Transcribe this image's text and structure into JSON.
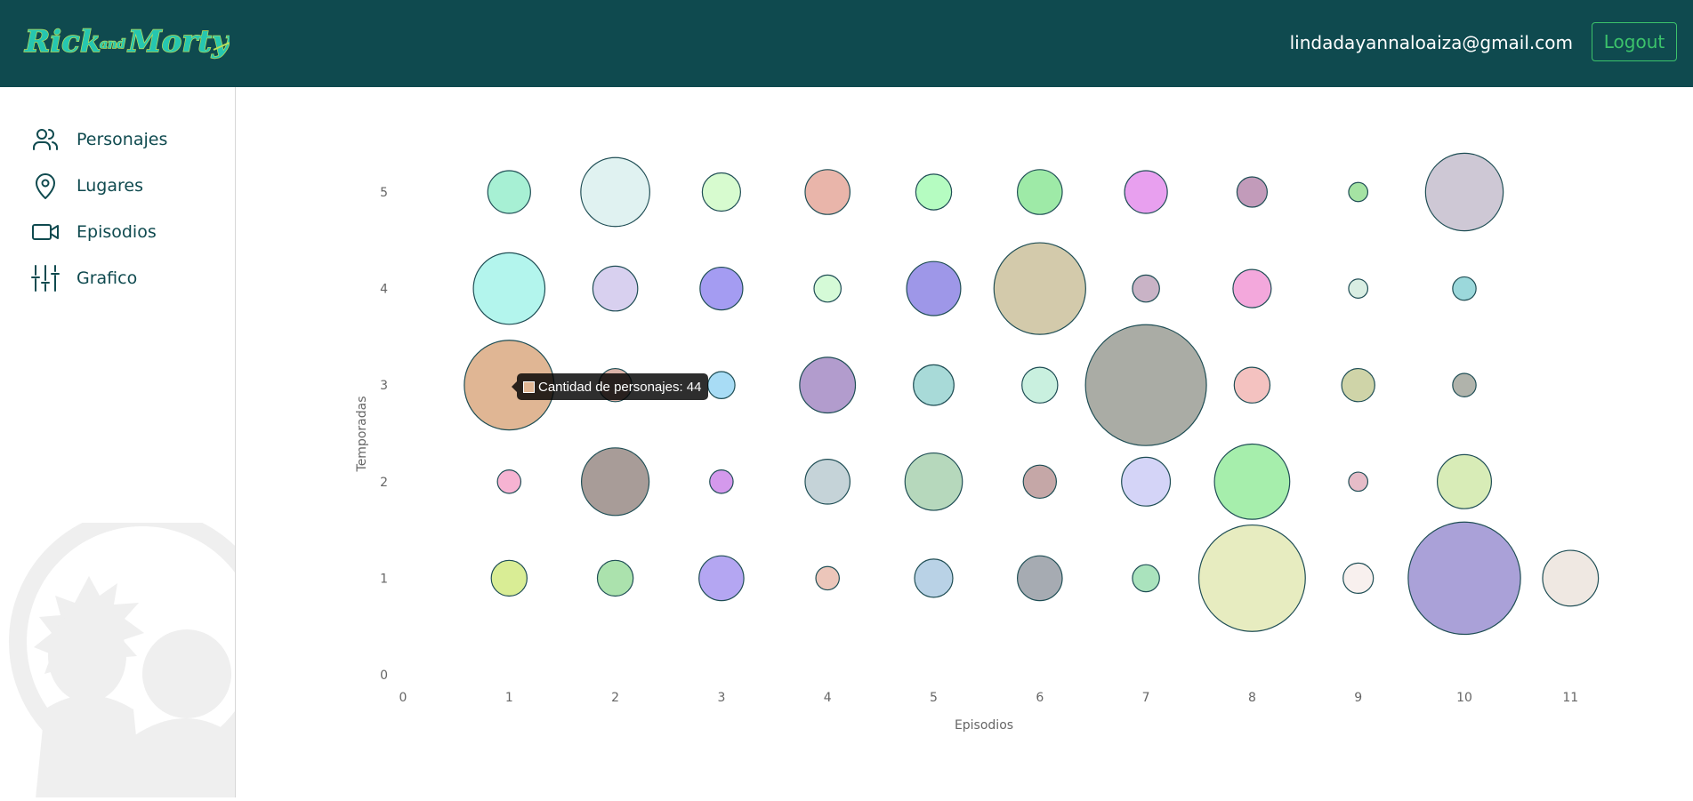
{
  "header": {
    "logo_text": "Rick and Morty",
    "user_email": "lindadayannaloaiza@gmail.com",
    "logout_label": "Logout",
    "colors": {
      "background": "#0f4a4f",
      "logout": "#3cc36b"
    }
  },
  "sidebar": {
    "items": [
      {
        "label": "Personajes",
        "icon": "users-icon"
      },
      {
        "label": "Lugares",
        "icon": "map-pin-icon"
      },
      {
        "label": "Episodios",
        "icon": "video-camera-icon"
      },
      {
        "label": "Grafico",
        "icon": "sliders-icon"
      }
    ],
    "watermark_icon": "rick-and-morty-silhouette-icon"
  },
  "tooltip": {
    "text": "Cantidad de personajes: 44",
    "swatch_color": "#e0b694"
  },
  "chart_data": {
    "type": "bubble",
    "xlabel": "Episodios",
    "ylabel": "Temporadas",
    "xlim": [
      0,
      11
    ],
    "ylim": [
      0,
      5
    ],
    "xticks": [
      "0",
      "1",
      "2",
      "3",
      "4",
      "5",
      "6",
      "7",
      "8",
      "9",
      "10",
      "11"
    ],
    "yticks": [
      "0",
      "1",
      "2",
      "3",
      "4",
      "5"
    ],
    "grid": false,
    "size_label": "Cantidad de personajes",
    "points": [
      {
        "x": 1,
        "y": 5,
        "size": 10,
        "color": "#a7f0d4"
      },
      {
        "x": 2,
        "y": 5,
        "size": 26,
        "color": "#e0f2f1"
      },
      {
        "x": 3,
        "y": 5,
        "size": 8,
        "color": "#d7fbcf"
      },
      {
        "x": 4,
        "y": 5,
        "size": 11,
        "color": "#e9b5aa"
      },
      {
        "x": 5,
        "y": 5,
        "size": 7,
        "color": "#b5fcc1"
      },
      {
        "x": 6,
        "y": 5,
        "size": 11,
        "color": "#9eeaa7"
      },
      {
        "x": 7,
        "y": 5,
        "size": 10,
        "color": "#e8a0ef"
      },
      {
        "x": 8,
        "y": 5,
        "size": 5,
        "color": "#c29bba"
      },
      {
        "x": 9,
        "y": 5,
        "size": 2,
        "color": "#a5e3a3"
      },
      {
        "x": 10,
        "y": 5,
        "size": 33,
        "color": "#cec8d5"
      },
      {
        "x": 1,
        "y": 4,
        "size": 28,
        "color": "#b3f5ed"
      },
      {
        "x": 2,
        "y": 4,
        "size": 11,
        "color": "#d8d0ef"
      },
      {
        "x": 3,
        "y": 4,
        "size": 10,
        "color": "#a49cf2"
      },
      {
        "x": 4,
        "y": 4,
        "size": 4,
        "color": "#d5fad7"
      },
      {
        "x": 5,
        "y": 4,
        "size": 16,
        "color": "#9e97e8"
      },
      {
        "x": 6,
        "y": 4,
        "size": 46,
        "color": "#d3caab"
      },
      {
        "x": 7,
        "y": 4,
        "size": 4,
        "color": "#c9b3c6"
      },
      {
        "x": 8,
        "y": 4,
        "size": 8,
        "color": "#f3a8dc"
      },
      {
        "x": 9,
        "y": 4,
        "size": 2,
        "color": "#d9eee3"
      },
      {
        "x": 10,
        "y": 4,
        "size": 3,
        "color": "#9bd8db"
      },
      {
        "x": 1,
        "y": 3,
        "size": 44,
        "color": "#e0b694"
      },
      {
        "x": 2,
        "y": 3,
        "size": 6,
        "color": "#dcb3a8"
      },
      {
        "x": 3,
        "y": 3,
        "size": 4,
        "color": "#a8dcf5"
      },
      {
        "x": 4,
        "y": 3,
        "size": 17,
        "color": "#b29ccd"
      },
      {
        "x": 5,
        "y": 3,
        "size": 9,
        "color": "#a8dad8"
      },
      {
        "x": 6,
        "y": 3,
        "size": 7,
        "color": "#c9f0df"
      },
      {
        "x": 7,
        "y": 3,
        "size": 80,
        "color": "#aaaca5"
      },
      {
        "x": 8,
        "y": 3,
        "size": 7,
        "color": "#f4c2c0"
      },
      {
        "x": 9,
        "y": 3,
        "size": 6,
        "color": "#cfd4a8"
      },
      {
        "x": 10,
        "y": 3,
        "size": 3,
        "color": "#b0b3ab"
      },
      {
        "x": 1,
        "y": 2,
        "size": 3,
        "color": "#f6b3d2"
      },
      {
        "x": 2,
        "y": 2,
        "size": 25,
        "color": "#a89c98"
      },
      {
        "x": 3,
        "y": 2,
        "size": 3,
        "color": "#d499ec"
      },
      {
        "x": 4,
        "y": 2,
        "size": 11,
        "color": "#c5d3d8"
      },
      {
        "x": 5,
        "y": 2,
        "size": 18,
        "color": "#b6d8bc"
      },
      {
        "x": 6,
        "y": 2,
        "size": 6,
        "color": "#c5a7a7"
      },
      {
        "x": 7,
        "y": 2,
        "size": 13,
        "color": "#d4d4f7"
      },
      {
        "x": 8,
        "y": 2,
        "size": 31,
        "color": "#a6eeac"
      },
      {
        "x": 9,
        "y": 2,
        "size": 2,
        "color": "#e6bcc8"
      },
      {
        "x": 10,
        "y": 2,
        "size": 16,
        "color": "#d8ecb7"
      },
      {
        "x": 1,
        "y": 1,
        "size": 7,
        "color": "#d9ed95"
      },
      {
        "x": 2,
        "y": 1,
        "size": 7,
        "color": "#abe2ad"
      },
      {
        "x": 3,
        "y": 1,
        "size": 11,
        "color": "#b4a6f2"
      },
      {
        "x": 4,
        "y": 1,
        "size": 3,
        "color": "#ecc6ba"
      },
      {
        "x": 5,
        "y": 1,
        "size": 8,
        "color": "#b9d2e6"
      },
      {
        "x": 6,
        "y": 1,
        "size": 11,
        "color": "#a6abb2"
      },
      {
        "x": 7,
        "y": 1,
        "size": 4,
        "color": "#aae3bd"
      },
      {
        "x": 8,
        "y": 1,
        "size": 62,
        "color": "#e7ecc0"
      },
      {
        "x": 9,
        "y": 1,
        "size": 5,
        "color": "#f8f0ee"
      },
      {
        "x": 10,
        "y": 1,
        "size": 69,
        "color": "#aaa1d8"
      },
      {
        "x": 11,
        "y": 1,
        "size": 17,
        "color": "#efe8e2"
      }
    ]
  }
}
